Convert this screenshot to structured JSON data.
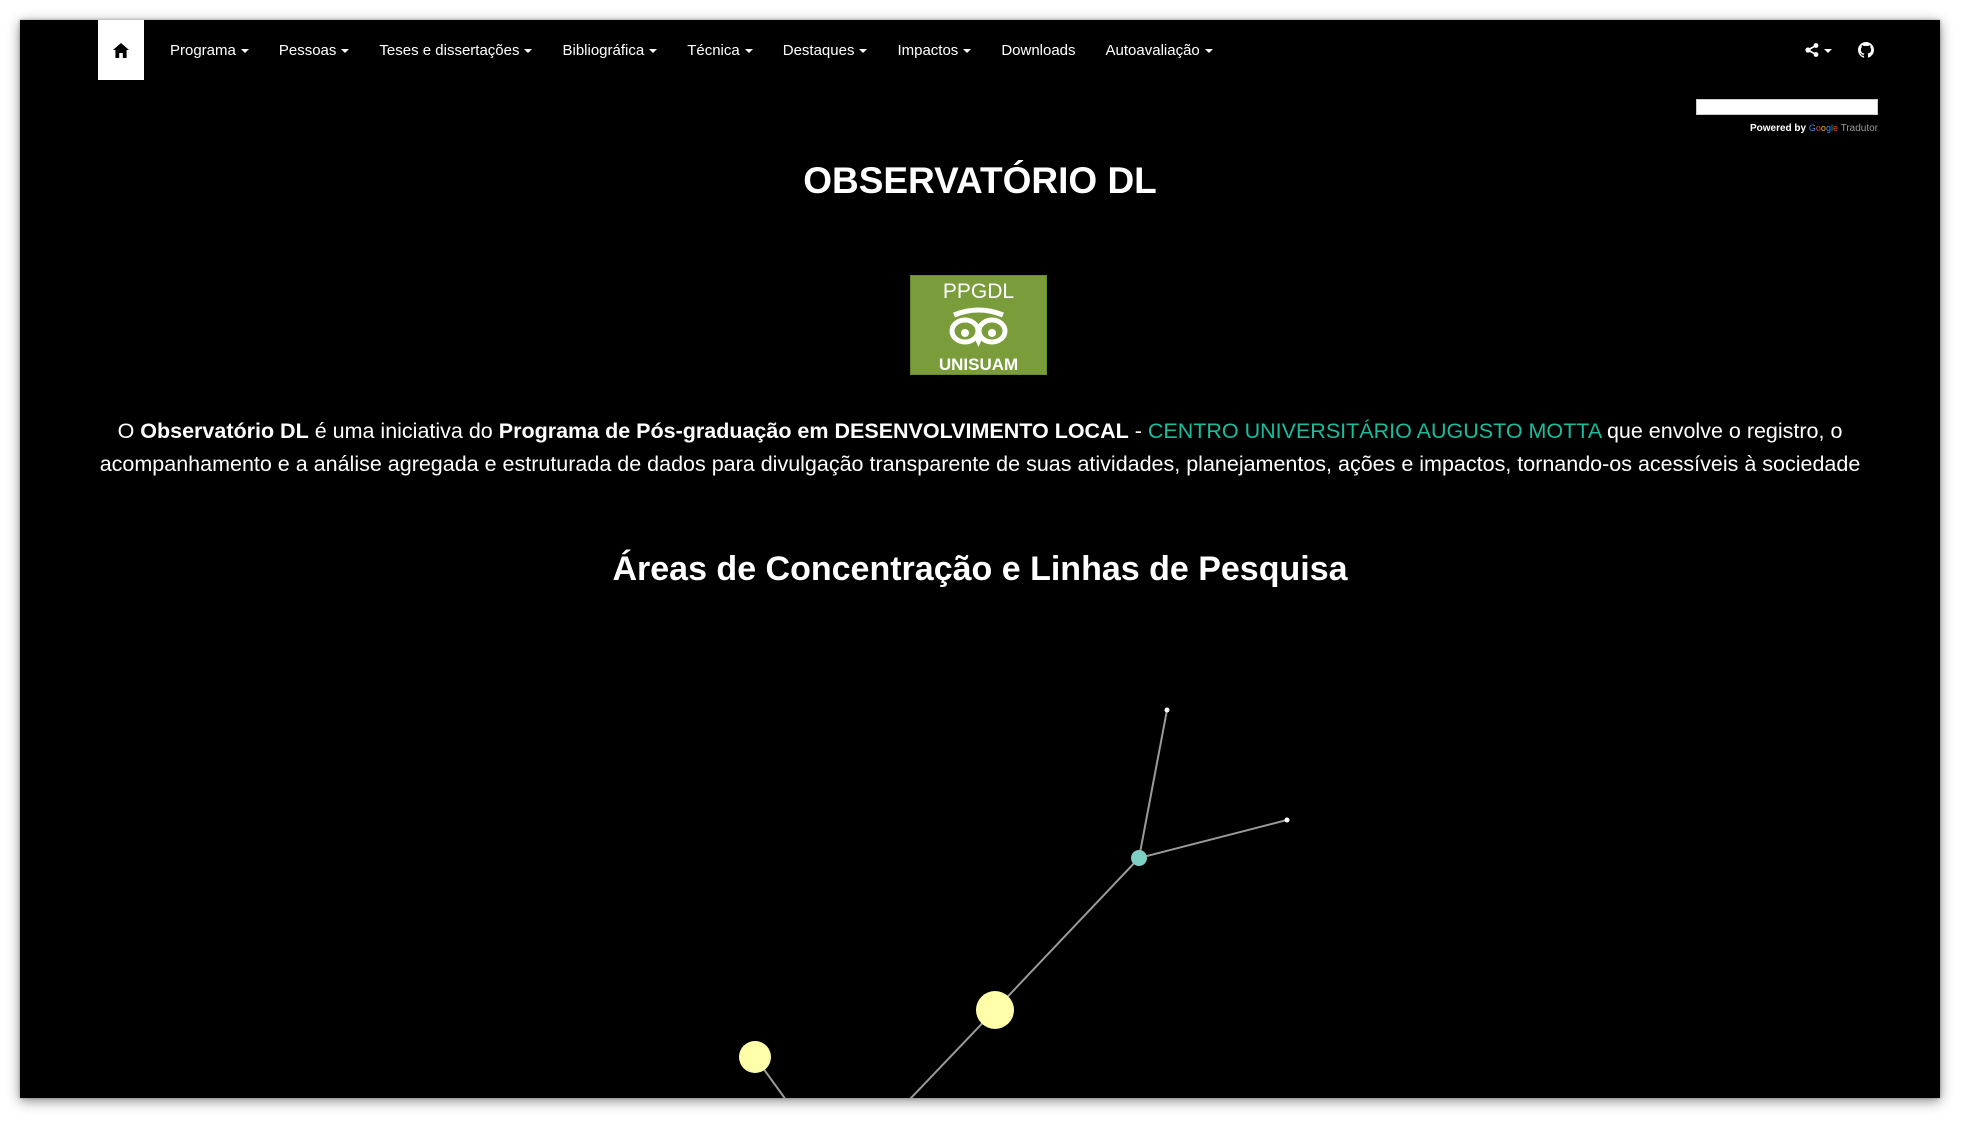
{
  "nav": {
    "home_icon": "home-icon",
    "items": [
      {
        "label": "Programa",
        "dropdown": true
      },
      {
        "label": "Pessoas",
        "dropdown": true
      },
      {
        "label": "Teses e dissertações",
        "dropdown": true
      },
      {
        "label": "Bibliográfica",
        "dropdown": true
      },
      {
        "label": "Técnica",
        "dropdown": true
      },
      {
        "label": "Destaques",
        "dropdown": true
      },
      {
        "label": "Impactos",
        "dropdown": true
      },
      {
        "label": "Downloads",
        "dropdown": false
      },
      {
        "label": "Autoavaliação",
        "dropdown": true
      }
    ],
    "share_icon": "share-icon",
    "github_icon": "github-icon"
  },
  "translate": {
    "powered_by": "Powered by",
    "google": "Google",
    "tradutor": "Tradutor"
  },
  "page": {
    "title": "OBSERVATÓRIO DL",
    "logo": {
      "top_text": "PPGDL",
      "bottom_text": "UNISUAM",
      "color": "#7a9c3a"
    },
    "intro": {
      "p1": "O ",
      "b1": "Observatório DL",
      "p2": " é uma iniciativa do ",
      "b2": "Programa de Pós-graduação em DESENVOLVIMENTO LOCAL",
      "p3": " - ",
      "link": "CENTRO UNIVERSITÁRIO AUGUSTO MOTTA",
      "p4": " que envolve o registro, o acompanhamento e a análise agregada e estruturada de dados para divulgação transparente de suas atividades, planejamentos, ações e impactos, tornando-os acessíveis à sociedade"
    },
    "section_title": "Áreas de Concentração e Linhas de Pesquisa"
  },
  "colors": {
    "background": "#000000",
    "link": "#1abc9c",
    "node_large": "#ffffaa",
    "node_mid": "#7ecfc4",
    "node_leaf": "#ffffff",
    "edge": "#9a9a9a"
  }
}
